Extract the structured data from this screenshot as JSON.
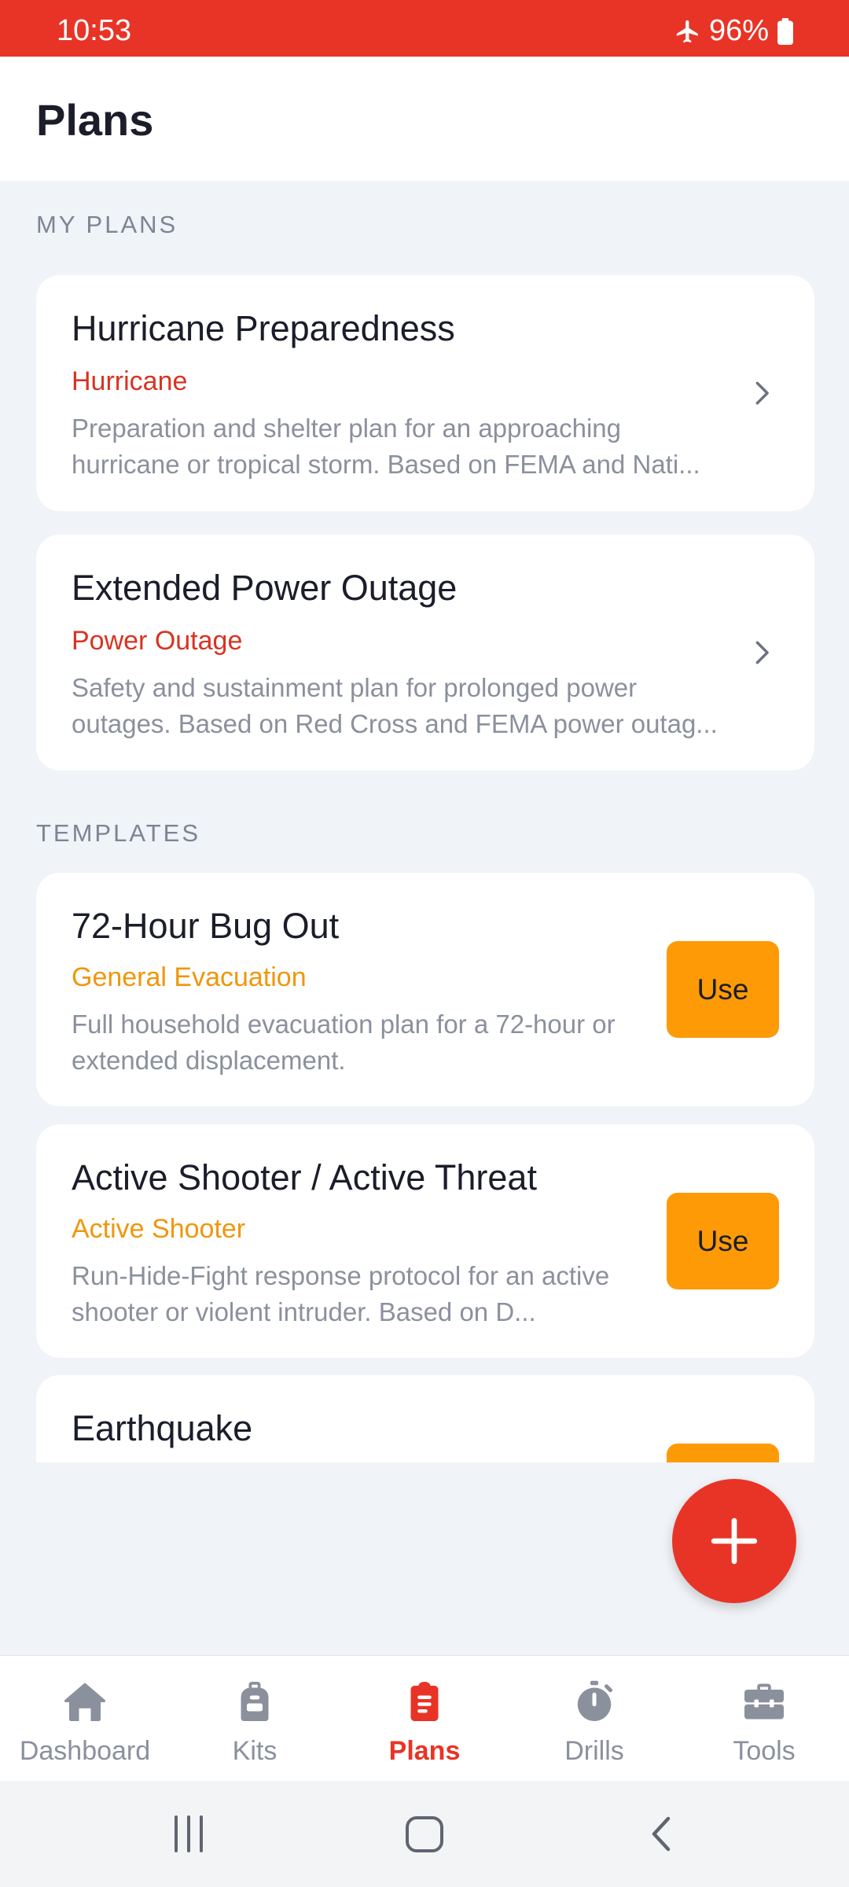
{
  "status_bar": {
    "time": "10:53",
    "battery": "96%",
    "airplane_icon": "airplane-icon",
    "battery_icon": "battery-icon"
  },
  "header": {
    "title": "Plans"
  },
  "my_plans": {
    "label": "MY PLANS",
    "items": [
      {
        "title": "Hurricane Preparedness",
        "category": "Hurricane",
        "description": "Preparation and shelter plan for an approaching hurricane or tropical storm. Based on FEMA and Nati..."
      },
      {
        "title": "Extended Power Outage",
        "category": "Power Outage",
        "description": "Safety and sustainment plan for prolonged power outages. Based on Red Cross and FEMA power outag..."
      }
    ]
  },
  "templates": {
    "label": "TEMPLATES",
    "use_label": "Use",
    "items": [
      {
        "title": "72-Hour Bug Out",
        "category": "General Evacuation",
        "description": "Full household evacuation plan for a 72-hour or extended displacement."
      },
      {
        "title": "Active Shooter / Active Threat",
        "category": "Active Shooter",
        "description": "Run-Hide-Fight response protocol for an active shooter or violent intruder. Based on D..."
      },
      {
        "title": "Earthquake"
      }
    ]
  },
  "fab": {
    "icon": "plus-icon"
  },
  "nav": {
    "items": [
      {
        "label": "Dashboard",
        "icon": "home-icon"
      },
      {
        "label": "Kits",
        "icon": "backpack-icon"
      },
      {
        "label": "Plans",
        "icon": "clipboard-icon",
        "active": true
      },
      {
        "label": "Drills",
        "icon": "stopwatch-icon"
      },
      {
        "label": "Tools",
        "icon": "toolbox-icon"
      }
    ]
  },
  "colors": {
    "accent": "#e83426",
    "use_button": "#fd9a05",
    "category_red": "#d93323",
    "category_orange": "#f0960b",
    "background": "#f0f3f7"
  }
}
